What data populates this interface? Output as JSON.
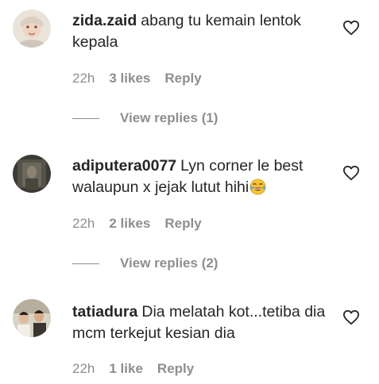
{
  "comments": [
    {
      "username": "zida.zaid",
      "text": "abang tu kemain lentok kepala",
      "emoji": "",
      "time": "22h",
      "likes": "3 likes",
      "reply": "Reply",
      "view_replies": "View replies (1)"
    },
    {
      "username": "adiputera0077",
      "text": "Lyn corner le best walaupun x jejak lutut hihi",
      "emoji": "😂",
      "time": "22h",
      "likes": "2 likes",
      "reply": "Reply",
      "view_replies": "View replies (2)"
    },
    {
      "username": "tatiadura",
      "text": "Dia melatah kot...tetiba dia mcm terkejut kesian dia",
      "emoji": "",
      "time": "22h",
      "likes": "1 like",
      "reply": "Reply",
      "view_replies": ""
    }
  ],
  "colors": {
    "text": "#262626",
    "secondary": "#8e8e8e",
    "background": "#ffffff"
  },
  "icons": {
    "like": "heart-outline-icon"
  }
}
